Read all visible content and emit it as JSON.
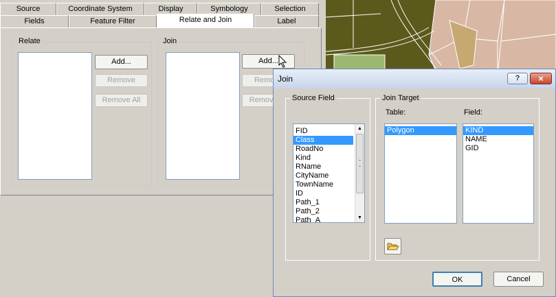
{
  "tabs_row1": [
    "Source",
    "Coordinate System",
    "Display",
    "Symbology",
    "Selection"
  ],
  "tabs_row2": [
    "Fields",
    "Feature Filter",
    "Relate and Join",
    "Label"
  ],
  "relate": {
    "label": "Relate",
    "add": "Add...",
    "remove": "Remove",
    "remove_all": "Remove All"
  },
  "join": {
    "label": "Join",
    "add": "Add...",
    "remove": "Remove",
    "remove_all": "Remove All"
  },
  "join_dialog": {
    "title": "Join",
    "source_field_label": "Source Field",
    "source_fields": [
      "FID",
      "Class",
      "RoadNo",
      "Kind",
      "RName",
      "CityName",
      "TownName",
      "ID",
      "Path_1",
      "Path_2",
      "Path_A"
    ],
    "selected_source_field": "Class",
    "join_target_label": "Join Target",
    "table_label": "Table:",
    "tables": [
      "Polygon"
    ],
    "selected_table": "Polygon",
    "field_label": "Field:",
    "fields": [
      "KIND",
      "NAME",
      "GID"
    ],
    "selected_field": "KIND",
    "ok": "OK",
    "cancel": "Cancel",
    "help_icon": "?",
    "close_icon": "×"
  },
  "colors": {
    "map_bg": "#5b5a1c",
    "parcel": "#d8b8a4",
    "selected": "#3399ff"
  }
}
